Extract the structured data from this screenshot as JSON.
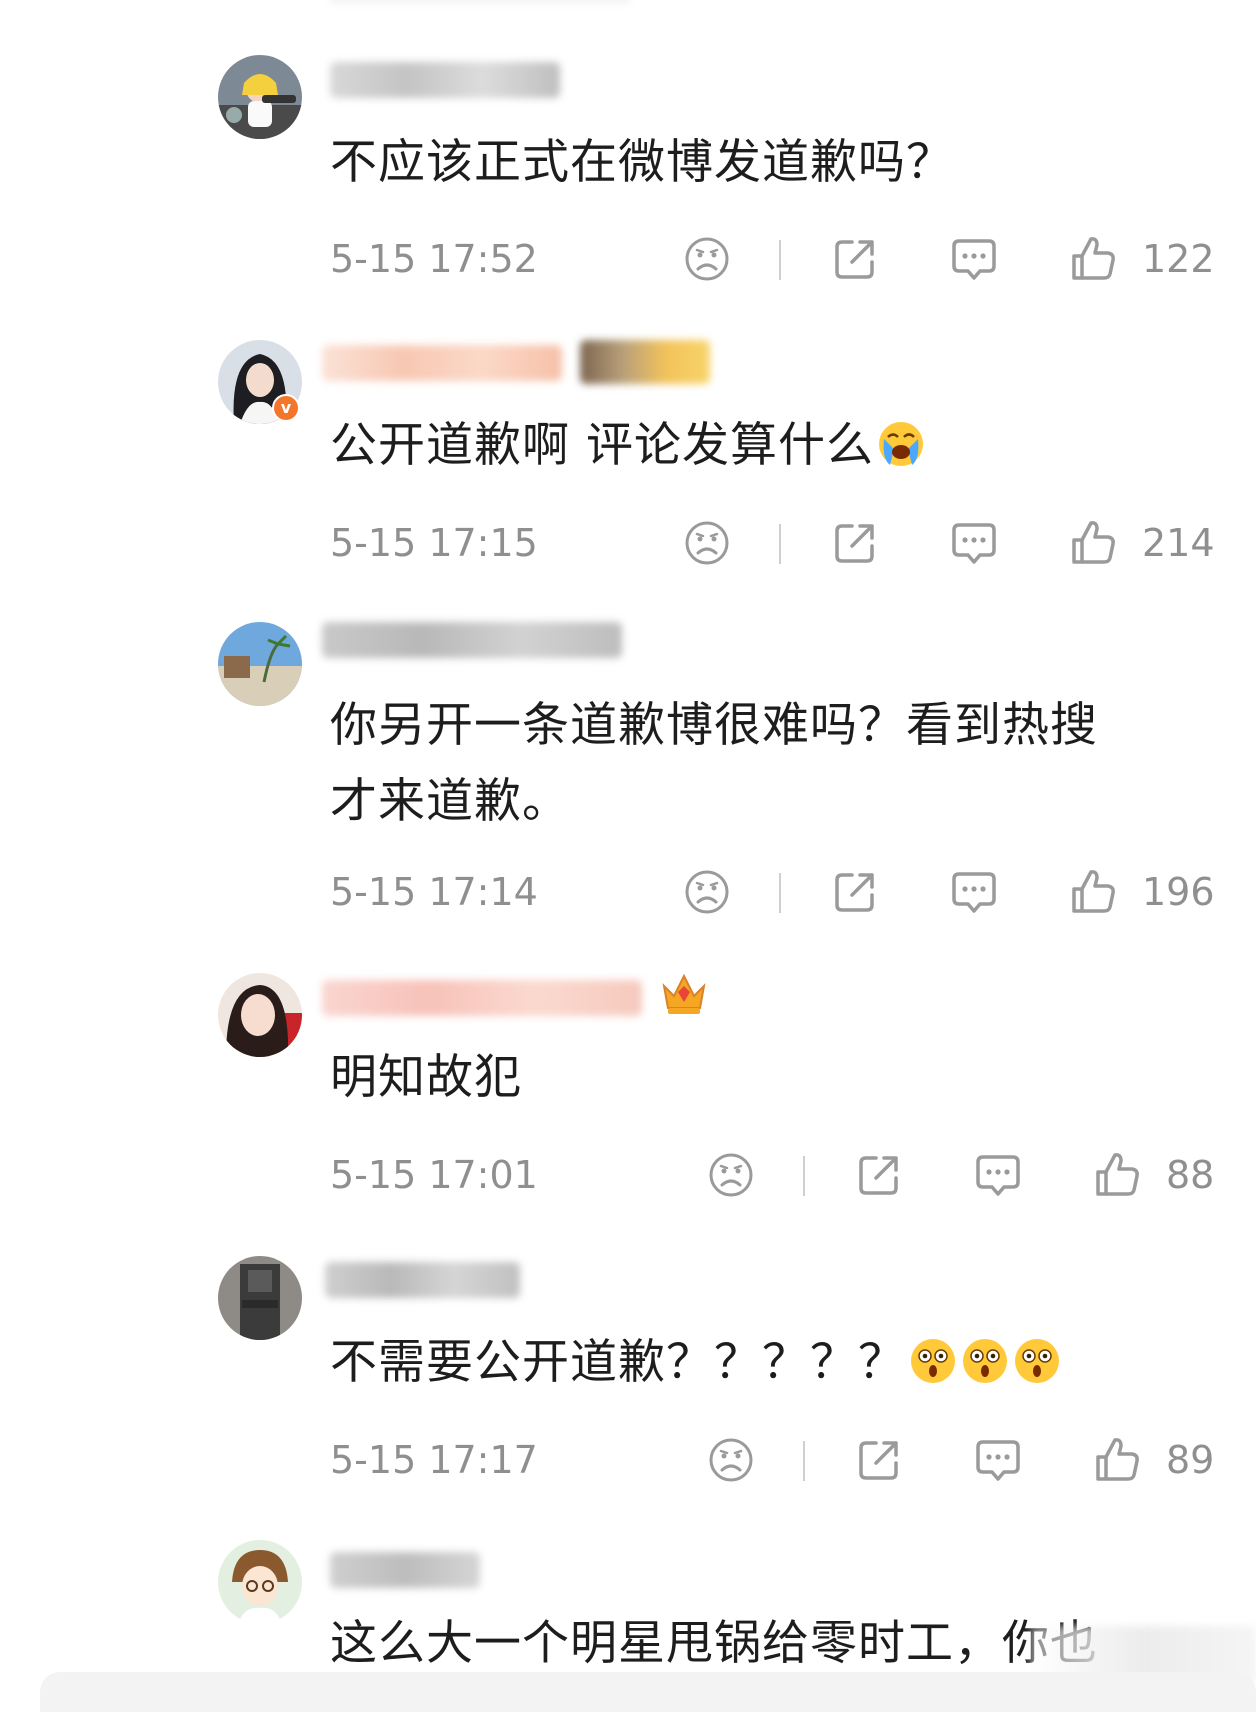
{
  "comments": [
    {
      "text": "不应该正式在微博发道歉吗？",
      "time": "5-15 17:52",
      "likes": "122"
    },
    {
      "text": "公开道歉啊 评论发算什么",
      "emoji": "loudly-crying-emoji",
      "time": "5-15 17:15",
      "likes": "214",
      "verified": "v"
    },
    {
      "text_line1": "你另开一条道歉博很难吗？看到热搜",
      "text_line2": "才来道歉。",
      "time": "5-15 17:14",
      "likes": "196"
    },
    {
      "text": "明知故犯",
      "badge": "crown-badge-icon",
      "time": "5-15 17:01",
      "likes": "88"
    },
    {
      "text": "不需要公开道歉？？？？？",
      "emoji": "astonished-face-emoji",
      "time": "5-15 17:17",
      "likes": "89"
    },
    {
      "text": "这么大一个明星甩锅给零时工，你也"
    }
  ],
  "icons": {
    "dislike": "sad-face-icon",
    "share": "share-icon",
    "reply": "comment-bubble-icon",
    "like": "thumbs-up-icon"
  },
  "colors": {
    "text": "#1d1d1d",
    "meta": "#8f8f8f",
    "verified_badge": "#f4762a"
  }
}
